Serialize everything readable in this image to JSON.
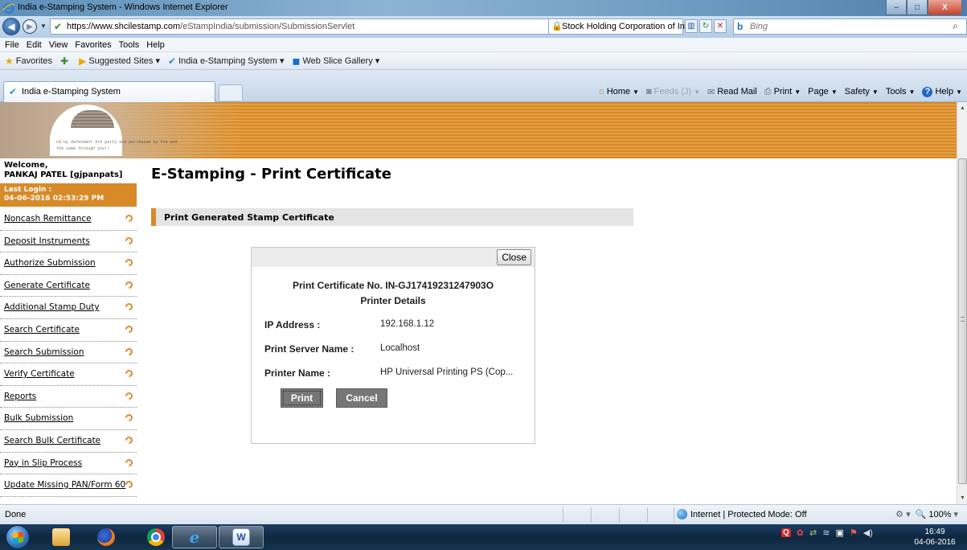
{
  "window": {
    "title": "India e-Stamping System - Windows Internet Explorer",
    "controls": {
      "minimize": "–",
      "maximize": "□",
      "close": "X"
    }
  },
  "address_bar": {
    "back": "◀",
    "forward": "▶",
    "url_host": "https://www.shcilestamp.com",
    "url_path": "/eStampIndia/submission/SubmissionServlet",
    "cert_owner": "Stock Holding Corporation of India ...",
    "search_placeholder": "Bing",
    "search_icon": "b"
  },
  "menu": [
    "File",
    "Edit",
    "View",
    "Favorites",
    "Tools",
    "Help"
  ],
  "favorites_bar": {
    "favorites": "Favorites",
    "suggested": "Suggested Sites ▾",
    "site": "India e-Stamping System ▾",
    "web_slice": "Web Slice Gallery ▾"
  },
  "tab": {
    "title": "India e-Stamping System"
  },
  "command_bar": {
    "home": "Home",
    "feeds": "Feeds (J)",
    "read_mail": "Read Mail",
    "print": "Print",
    "page": "Page",
    "safety": "Safety",
    "tools": "Tools",
    "help": "Help"
  },
  "banner": {
    "scribble_line1": "nd by defendant 3rd party and purchased by him and",
    "scribble_line2": "the same through you!!"
  },
  "sidebar": {
    "welcome_line1": "Welcome,",
    "welcome_line2": "PANKAJ PATEL [gjpanpats]",
    "last_login_label": "Last Login :",
    "last_login_value": "04-06-2016 02:53:29 PM",
    "items": [
      "Noncash Remittance",
      "Deposit Instruments",
      "Authorize Submission",
      "Generate Certificate",
      "Additional Stamp Duty",
      "Search Certificate",
      "Search Submission",
      "Verify Certificate",
      "Reports",
      "Bulk Submission",
      "Search Bulk Certificate",
      "Pay in Slip Process",
      "Update Missing PAN/Form 60"
    ]
  },
  "main": {
    "page_title": "E-Stamping - Print Certificate",
    "section_title": "Print Generated Stamp Certificate"
  },
  "dialog": {
    "close_label": "Close",
    "certificate_line": "Print Certificate No. IN-GJ17419231247903O",
    "details_heading": "Printer Details",
    "ip_label": "IP Address :",
    "ip_value": "192.168.1.12",
    "server_label": "Print Server Name :",
    "server_value": "Localhost",
    "printer_label": "Printer Name :",
    "printer_value": "HP Universal Printing PS (Cop...",
    "print_label": "Print",
    "cancel_label": "Cancel"
  },
  "status_bar": {
    "status": "Done",
    "zone": "Internet | Protected Mode: Off",
    "zoom": "100%"
  },
  "taskbar": {
    "clock_time": "16:49",
    "clock_date": "04-06-2016",
    "word_glyph": "W",
    "ie_glyph": "e"
  },
  "colors": {
    "accent_orange": "#d88a28",
    "button_gray": "#777777",
    "section_gray": "#e4e4e4"
  },
  "icons": {
    "favorites": "star-icon",
    "add_favorite": "plus-icon",
    "home": "home-icon",
    "feeds": "feed-icon",
    "mail": "mail-icon",
    "print": "printer-icon",
    "help": "help-icon",
    "menu_arrow": "arrow-circle-icon"
  }
}
